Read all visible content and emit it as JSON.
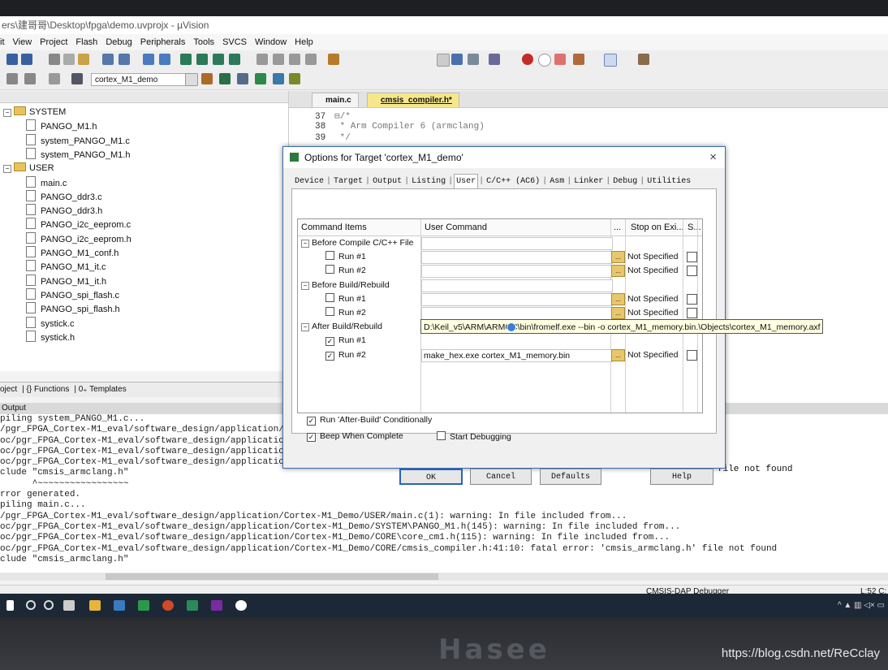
{
  "window": {
    "title": "ers\\建哥哥\\Desktop\\fpga\\demo.uvprojx - µVision"
  },
  "menu": [
    "it",
    "View",
    "Project",
    "Flash",
    "Debug",
    "Peripherals",
    "Tools",
    "SVCS",
    "Window",
    "Help"
  ],
  "toolbar": {
    "target": "cortex_M1_demo"
  },
  "project_tree": [
    {
      "label": "SYSTEM",
      "kind": "folder",
      "indent": 0
    },
    {
      "label": "PANGO_M1.h",
      "kind": "file",
      "indent": 1
    },
    {
      "label": "system_PANGO_M1.c",
      "kind": "file",
      "indent": 1
    },
    {
      "label": "system_PANGO_M1.h",
      "kind": "file",
      "indent": 1
    },
    {
      "label": "USER",
      "kind": "folder",
      "indent": 0
    },
    {
      "label": "main.c",
      "kind": "file",
      "indent": 1
    },
    {
      "label": "PANGO_ddr3.c",
      "kind": "file",
      "indent": 1
    },
    {
      "label": "PANGO_ddr3.h",
      "kind": "file",
      "indent": 1
    },
    {
      "label": "PANGO_i2c_eeprom.c",
      "kind": "file",
      "indent": 1
    },
    {
      "label": "PANGO_i2c_eeprom.h",
      "kind": "file",
      "indent": 1
    },
    {
      "label": "PANGO_M1_conf.h",
      "kind": "file",
      "indent": 1
    },
    {
      "label": "PANGO_M1_it.c",
      "kind": "file",
      "indent": 1
    },
    {
      "label": "PANGO_M1_it.h",
      "kind": "file",
      "indent": 1
    },
    {
      "label": "PANGO_spi_flash.c",
      "kind": "file",
      "indent": 1
    },
    {
      "label": "PANGO_spi_flash.h",
      "kind": "file",
      "indent": 1
    },
    {
      "label": "systick.c",
      "kind": "file",
      "indent": 1
    },
    {
      "label": "systick.h",
      "kind": "file",
      "indent": 1
    }
  ],
  "project_tabs": [
    "oject",
    "{} Functions",
    "0₊ Templates"
  ],
  "editor": {
    "tabs": [
      "main.c",
      "cmsis_compiler.h*"
    ],
    "lines": [
      {
        "num": "37",
        "text": "⊟/*"
      },
      {
        "num": "38",
        "text": "  * Arm Compiler 6 (armclang)"
      },
      {
        "num": "39",
        "text": "  */"
      }
    ]
  },
  "output": {
    "title": "Output",
    "lines": [
      "piling system_PANGO_M1.c...",
      "/pgr_FPGA_Cortex-M1_eval/software_design/application/(",
      "oc/pgr_FPGA_Cortex-M1_eval/software_design/application",
      "oc/pgr_FPGA_Cortex-M1_eval/software_design/application",
      "oc/pgr_FPGA_Cortex-M1_eval/software_design/application",
      "clude \"cmsis_armclang.h\"",
      "      ^~~~~~~~~~~~~~~~~~",
      "rror generated.",
      "piling main.c...",
      "/pgr_FPGA_Cortex-M1_eval/software_design/application/Cortex-M1_Demo/USER/main.c(1): warning: In file included from...",
      "oc/pgr_FPGA_Cortex-M1_eval/software_design/application/Cortex-M1_Demo/SYSTEM\\PANGO_M1.h(145): warning: In file included from...",
      "oc/pgr_FPGA_Cortex-M1_eval/software_design/application/Cortex-M1_Demo/CORE\\core_cm1.h(115): warning: In file included from...",
      "oc/pgr_FPGA_Cortex-M1_eval/software_design/application/Cortex-M1_Demo/CORE/cmsis_compiler.h:41:10: fatal error: 'cmsis_armclang.h' file not found",
      "clude \"cmsis_armclang.h\""
    ],
    "behind_dialog_text": "file not found"
  },
  "status": {
    "debugger": "CMSIS-DAP Debugger",
    "position": "L:52 C:"
  },
  "dialog": {
    "title": "Options for Target 'cortex_M1_demo'",
    "close": "×",
    "tabs": [
      "Device",
      "Target",
      "Output",
      "Listing",
      "User",
      "C/C++ (AC6)",
      "Asm",
      "Linker",
      "Debug",
      "Utilities"
    ],
    "active_tab": "User",
    "columns": [
      "Command Items",
      "User Command",
      "...",
      "Stop on Exi...",
      "S..."
    ],
    "rows": [
      {
        "type": "group",
        "label": "Before Compile C/C++ File"
      },
      {
        "type": "item",
        "label": "Run #1",
        "checked": false,
        "command": "",
        "stop": "Not Specified"
      },
      {
        "type": "item",
        "label": "Run #2",
        "checked": false,
        "command": "",
        "stop": "Not Specified"
      },
      {
        "type": "group",
        "label": "Before Build/Rebuild"
      },
      {
        "type": "item",
        "label": "Run #1",
        "checked": false,
        "command": "",
        "stop": "Not Specified"
      },
      {
        "type": "item",
        "label": "Run #2",
        "checked": false,
        "command": "",
        "stop": "Not Specified"
      },
      {
        "type": "group",
        "label": "After Build/Rebuild"
      },
      {
        "type": "item",
        "label": "Run #1",
        "checked": true,
        "command": "D:\\Keil_v5\\ARM\\ARMCC\\bin\\fromelf.exe --bin -o cortex_M1_memory.bin.\\Objects\\cortex_M1_memory.axf",
        "stop": ""
      },
      {
        "type": "item",
        "label": "Run #2",
        "checked": true,
        "command": "make_hex.exe cortex_M1_memory.bin",
        "stop": "Not Specified"
      }
    ],
    "tooltip": "D:\\Keil_v5\\ARM\\ARMCC\\bin\\fromelf.exe --bin -o cortex_M1_memory.bin.\\Objects\\cortex_M1_memory.axf",
    "options": {
      "run_after_build": {
        "label": "Run 'After-Build' Conditionally",
        "checked": true
      },
      "beep": {
        "label": "Beep When Complete",
        "checked": true
      },
      "start_debug": {
        "label": "Start Debugging",
        "checked": false
      }
    },
    "buttons": {
      "ok": "OK",
      "cancel": "Cancel",
      "defaults": "Defaults",
      "help": "Help"
    }
  },
  "bezel": {
    "brand": "Hasee",
    "watermark": "https://blog.csdn.net/ReCclay"
  }
}
